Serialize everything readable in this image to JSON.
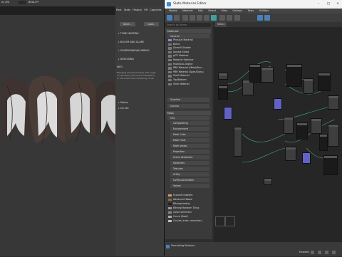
{
  "main_window": {
    "title": "ns (M)",
    "top_label": "BEAUTY"
  },
  "render_panel": {
    "tabs": [
      "Post",
      "Stats",
      "History",
      "Eff",
      "Captures"
    ],
    "save_label": "Save...",
    "load_label": "Load...",
    "sections": [
      "TONE MAPPING",
      "BLOOM AND GLARE",
      "SHARPENING/BLURRING",
      "DENOISING"
    ],
    "info_title": "INFO",
    "info_text": [
      "Blending denoised image with origin",
      "no denoising amount is available or",
      "in non-interactive rendering mode"
    ],
    "lower_sections": [
      "Stacks",
      "Curves"
    ]
  },
  "slate": {
    "title": "Slate Material Editor",
    "menu": [
      "Modes",
      "Material",
      "Edit",
      "Select",
      "View",
      "Options",
      "Tools",
      "Utilities"
    ],
    "view_tab": "View1",
    "search_placeholder": "Search by Name ...",
    "materials_header": "Materials",
    "general_header": "General",
    "general_items": [
      "Physical Material",
      "Blend",
      "DirectX Shader",
      "Double Sided",
      "glTF Material",
      "Material Switcher",
      "Multi/Sub-Object",
      "PBR Material (Metal/Rou...",
      "PBR Material (Spec/Gloss)",
      "Shell Material",
      "Top/Bottom",
      "Shell Material"
    ],
    "scanline_header": "Scanline",
    "corona_header": "Corona",
    "maps_header": "Maps",
    "osl_header": "OSL",
    "osl_groups": [
      "Compositing",
      "Environment",
      "Math Color",
      "Math Float",
      "Math Vector",
      "Projection",
      "Scene Attributes",
      "Switchers",
      "Textures",
      "Utility",
      "UVW/Coordinates",
      "Values"
    ],
    "general_maps": [
      "Ground Gradient",
      "Advanced Wood",
      "BitmapLookup",
      "Bitmap Random Tiling",
      "ColorCorrection",
      "Curve (float)",
      "Curves (color correction)"
    ],
    "status_text": "Simulating finished",
    "zoom_label": "Enabled",
    "colors": {
      "node_blue": "#6464c8",
      "wire": "#4aa87e",
      "panel": "#3a3a3a"
    }
  }
}
